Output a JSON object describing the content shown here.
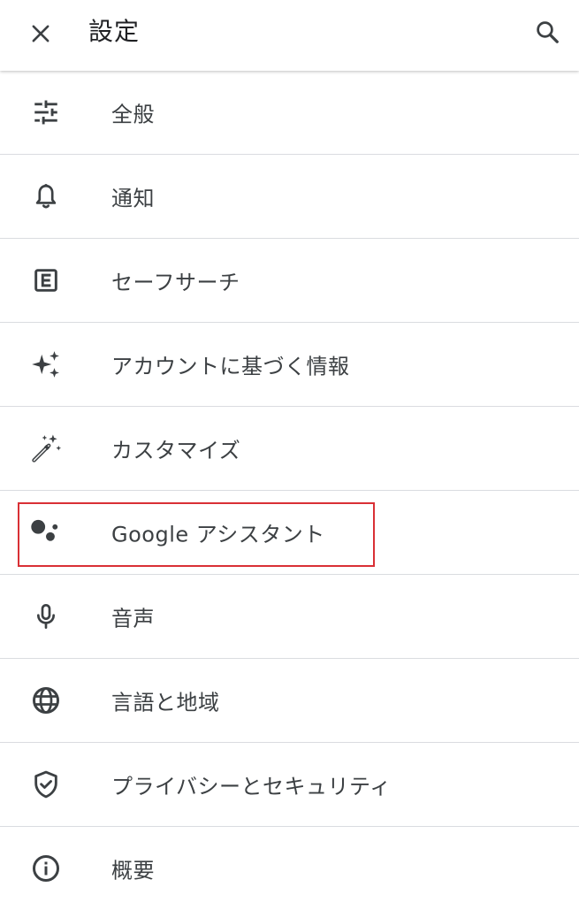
{
  "app_bar": {
    "title": "設定",
    "close_icon": "close-icon",
    "search_icon": "search-icon"
  },
  "items": [
    {
      "label": "全般",
      "icon": "tune-icon"
    },
    {
      "label": "通知",
      "icon": "bell-icon"
    },
    {
      "label": "セーフサーチ",
      "icon": "explicit-icon"
    },
    {
      "label": "アカウントに基づく情報",
      "icon": "sparkle-icon"
    },
    {
      "label": "カスタマイズ",
      "icon": "magic-wand-icon"
    },
    {
      "label": "Google アシスタント",
      "icon": "google-assistant-icon"
    },
    {
      "label": "音声",
      "icon": "microphone-icon"
    },
    {
      "label": "言語と地域",
      "icon": "globe-icon"
    },
    {
      "label": "プライバシーとセキュリティ",
      "icon": "shield-check-icon"
    },
    {
      "label": "概要",
      "icon": "info-icon"
    }
  ],
  "colors": {
    "icon": "#3c4043",
    "divider": "#dadce0",
    "highlight": "#d93035"
  }
}
